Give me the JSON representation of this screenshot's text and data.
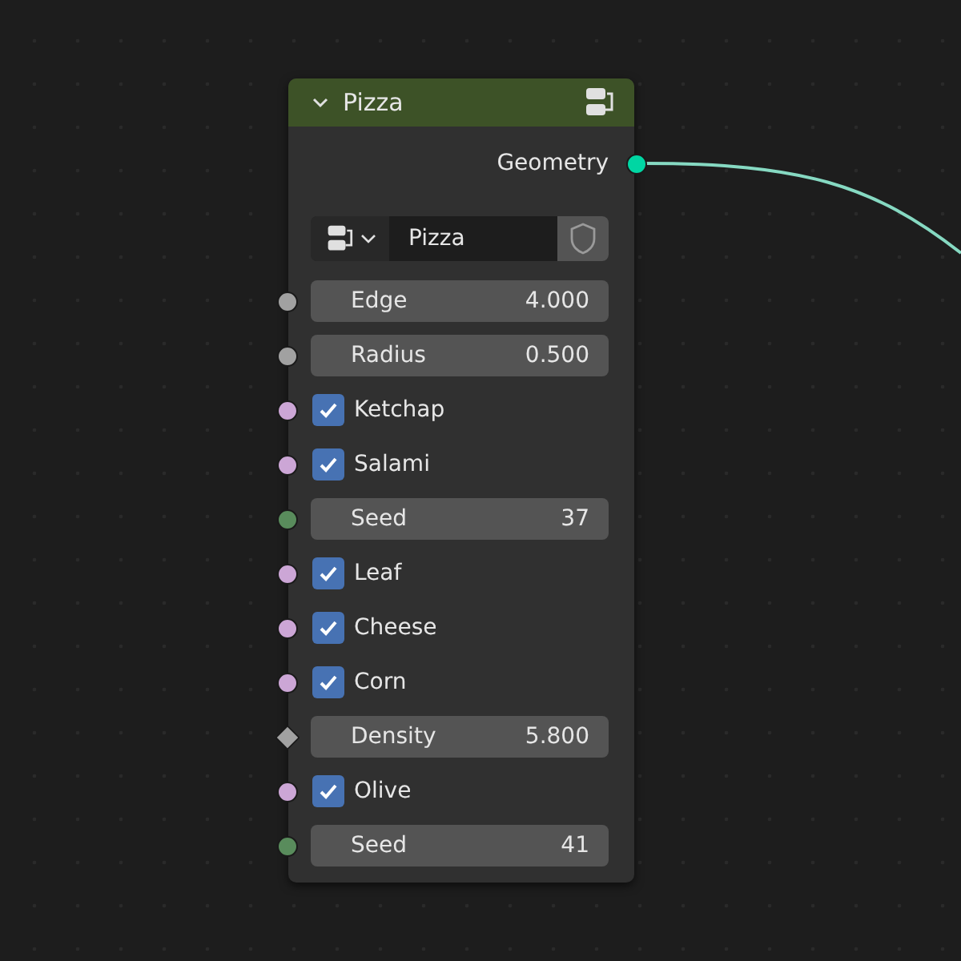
{
  "node": {
    "title": "Pizza",
    "collapsed": false,
    "output": {
      "label": "Geometry",
      "color": "#00d6a3"
    },
    "group": {
      "name": "Pizza"
    },
    "inputs": [
      {
        "kind": "value",
        "label": "Edge",
        "value": "4.000",
        "socket": {
          "kind": "circle",
          "color": "#a1a1a1"
        }
      },
      {
        "kind": "value",
        "label": "Radius",
        "value": "0.500",
        "socket": {
          "kind": "circle",
          "color": "#a1a1a1"
        }
      },
      {
        "kind": "checkbox",
        "label": "Ketchap",
        "checked": true,
        "socket": {
          "kind": "circle",
          "color": "#cca6d6"
        }
      },
      {
        "kind": "checkbox",
        "label": "Salami",
        "checked": true,
        "socket": {
          "kind": "circle",
          "color": "#cca6d6"
        }
      },
      {
        "kind": "value",
        "label": "Seed",
        "value": "37",
        "socket": {
          "kind": "circle",
          "color": "#598c5c"
        }
      },
      {
        "kind": "checkbox",
        "label": "Leaf",
        "checked": true,
        "socket": {
          "kind": "circle",
          "color": "#cca6d6"
        }
      },
      {
        "kind": "checkbox",
        "label": "Cheese",
        "checked": true,
        "socket": {
          "kind": "circle",
          "color": "#cca6d6"
        }
      },
      {
        "kind": "checkbox",
        "label": "Corn",
        "checked": true,
        "socket": {
          "kind": "circle",
          "color": "#cca6d6"
        }
      },
      {
        "kind": "value",
        "label": "Density",
        "value": "5.800",
        "socket": {
          "kind": "diamond",
          "color": "#a1a1a1"
        }
      },
      {
        "kind": "checkbox",
        "label": "Olive",
        "checked": true,
        "socket": {
          "kind": "circle",
          "color": "#cca6d6"
        }
      },
      {
        "kind": "value",
        "label": "Seed",
        "value": "41",
        "socket": {
          "kind": "circle",
          "color": "#598c5c"
        }
      }
    ]
  }
}
